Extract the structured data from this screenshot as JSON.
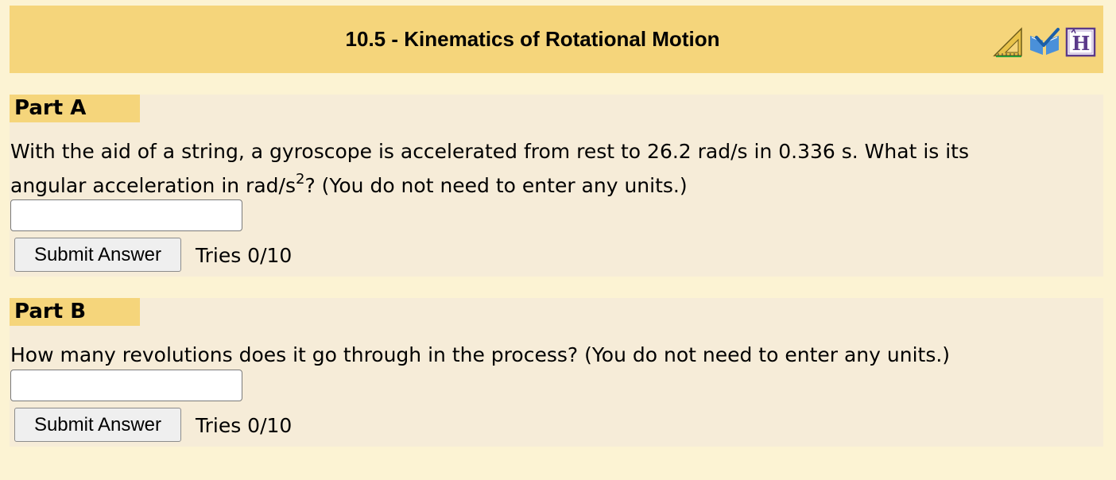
{
  "header": {
    "title": "10.5 - Kinematics of Rotational Motion",
    "icons": [
      "ruler-triangle-icon",
      "book-check-icon",
      "help-h-icon"
    ]
  },
  "part_a": {
    "label": "Part A",
    "question_line1": "With the aid of a string, a gyroscope is accelerated from rest to 26.2 rad/s in 0.336 s. What is its",
    "question_line2_pre": "angular acceleration in rad/s",
    "question_sup": "2",
    "question_line2_post": "? (You do not need to enter any units.)",
    "answer_value": "",
    "submit_label": "Submit Answer",
    "tries": "Tries 0/10"
  },
  "part_b": {
    "label": "Part B",
    "question": "How many revolutions does it go through in the process? (You do not need to enter any units.)",
    "answer_value": "",
    "submit_label": "Submit Answer",
    "tries": "Tries 0/10"
  },
  "colors": {
    "page_background": "#fcf3d3",
    "header_background": "#f5d57b",
    "part_background": "#f6ecd8",
    "label_background": "#f5d57b"
  }
}
